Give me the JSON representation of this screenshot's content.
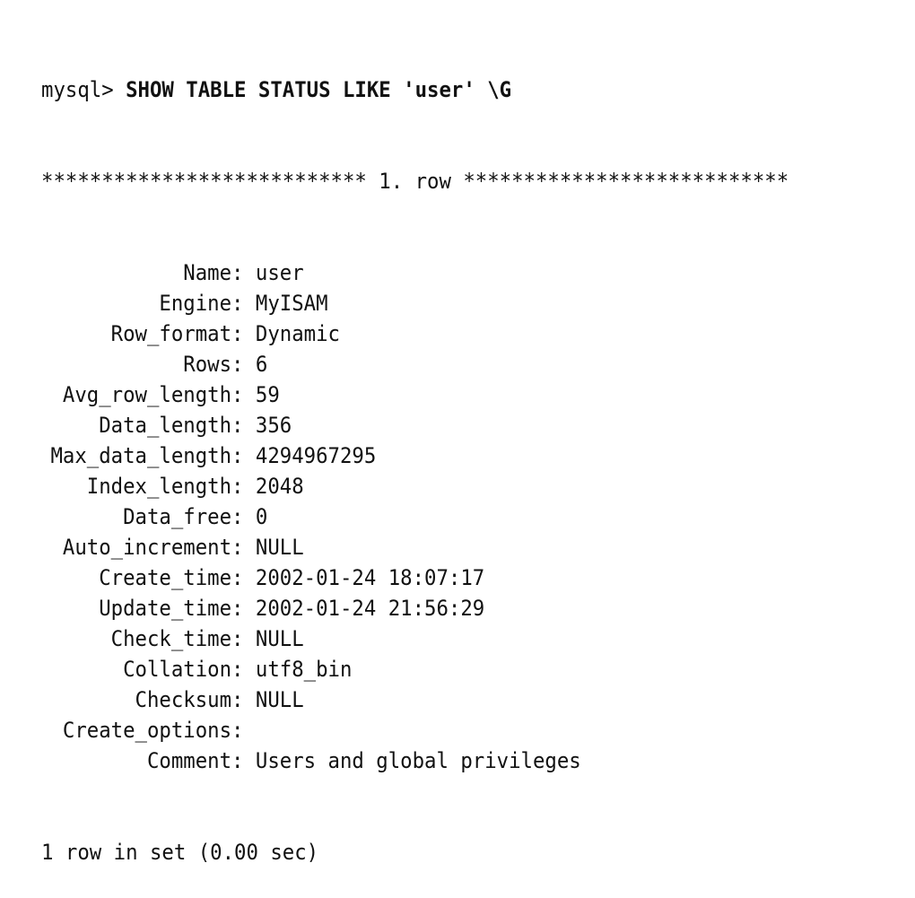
{
  "console": {
    "prompt": "mysql> ",
    "command": "SHOW TABLE STATUS LIKE 'user' \\G",
    "row_header": "*************************** 1. row ***************************",
    "separator": ": ",
    "fields": [
      {
        "name": "Name",
        "value": "user"
      },
      {
        "name": "Engine",
        "value": "MyISAM"
      },
      {
        "name": "Row_format",
        "value": "Dynamic"
      },
      {
        "name": "Rows",
        "value": "6"
      },
      {
        "name": "Avg_row_length",
        "value": "59"
      },
      {
        "name": "Data_length",
        "value": "356"
      },
      {
        "name": "Max_data_length",
        "value": "4294967295"
      },
      {
        "name": "Index_length",
        "value": "2048"
      },
      {
        "name": "Data_free",
        "value": "0"
      },
      {
        "name": "Auto_increment",
        "value": "NULL"
      },
      {
        "name": "Create_time",
        "value": "2002-01-24 18:07:17"
      },
      {
        "name": "Update_time",
        "value": "2002-01-24 21:56:29"
      },
      {
        "name": "Check_time",
        "value": "NULL"
      },
      {
        "name": "Collation",
        "value": "utf8_bin"
      },
      {
        "name": "Checksum",
        "value": "NULL"
      },
      {
        "name": "Create_options",
        "value": ""
      },
      {
        "name": "Comment",
        "value": "Users and global privileges"
      }
    ],
    "footer": "1 row in set (0.00 sec)"
  }
}
